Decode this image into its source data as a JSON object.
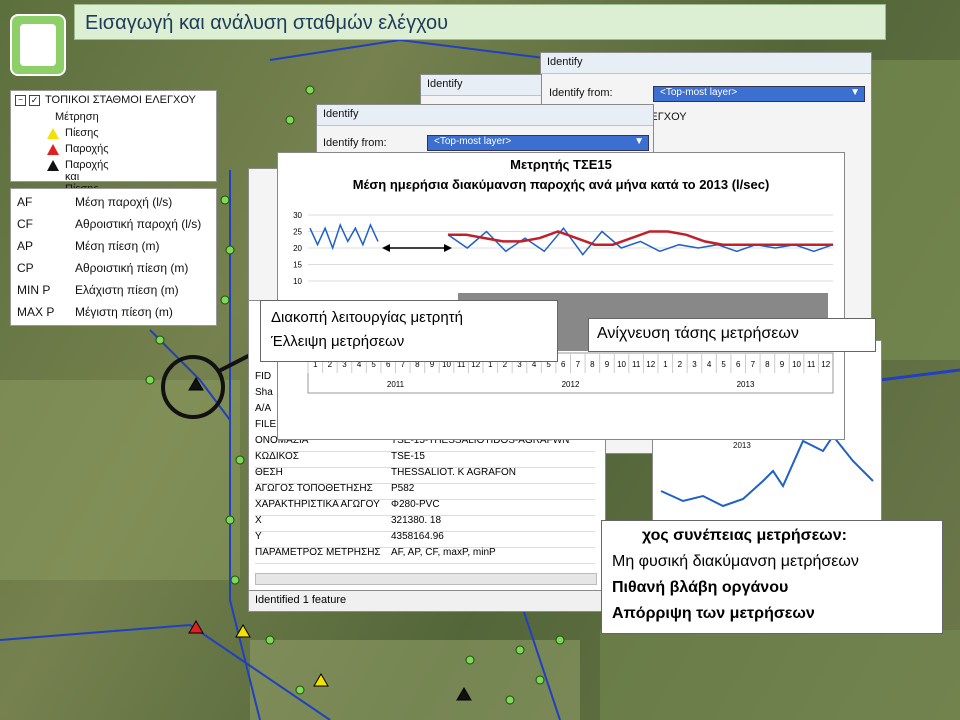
{
  "header": {
    "title": "Εισαγωγή και ανάλυση σταθμών ελέγχου"
  },
  "legend": {
    "layer": "ΤΟΠΙΚΟΙ ΣΤΑΘΜΟΙ ΕΛΕΓΧΟΥ",
    "group": "Μέτρηση",
    "items": [
      {
        "label": "Πίεσης",
        "color": "#f5e000"
      },
      {
        "label": "Παροχής",
        "color": "#e02020"
      },
      {
        "label": "Παροχής και Πίεσης",
        "color": "#111111"
      }
    ]
  },
  "abbreviations": [
    {
      "code": "AF",
      "desc": "Μέση παροχή (l/s)"
    },
    {
      "code": "CF",
      "desc": "Αθροιστική παροχή (l/s)"
    },
    {
      "code": "AP",
      "desc": "Μέση πίεση (m)"
    },
    {
      "code": "CP",
      "desc": "Αθροιστική πίεση (m)"
    },
    {
      "code": "MIN P",
      "desc": "Ελάχιστη πίεση (m)"
    },
    {
      "code": "MAX P",
      "desc": "Μέγιστη πίεση (m)"
    }
  ],
  "identify_windows": [
    {
      "title": "Identify",
      "from_label": "Identify from:",
      "from_value": "<Top-most layer>"
    },
    {
      "title": "Identify",
      "from_label": "",
      "from_value": ""
    },
    {
      "title": "Identify",
      "from_label": "Identify from:",
      "from_value": "<Top-most layer>"
    }
  ],
  "right_window_layer": "ΟΙ ΕΛΕΓΧΟΥ",
  "chart": {
    "title_line1": "Μετρητής ΤΣΕ15",
    "title_line2": "Μέση ημερήσια διακύμανση παροχής ανά μήνα κατά το 2013 (l/sec)",
    "yticks": [
      "30",
      "25",
      "20",
      "15",
      "10"
    ],
    "months": [
      "1",
      "2",
      "3",
      "4",
      "5",
      "6",
      "7",
      "8",
      "9",
      "10",
      "11",
      "12"
    ],
    "years": [
      "2011",
      "2012",
      "2013"
    ]
  },
  "chart_data": {
    "type": "line",
    "title": "Μετρητής ΤΣΕ15",
    "subtitle": "Μέση ημερήσια διακύμανση παροχής ανά μήνα κατά το 2013 (l/sec)",
    "ylim": [
      10,
      30
    ],
    "series": [
      {
        "values": [
          26,
          21,
          26,
          20,
          27,
          22,
          26,
          21,
          27,
          22
        ]
      },
      {
        "values": [
          24,
          20,
          25,
          19,
          23,
          19,
          26,
          18,
          25,
          20,
          22,
          19,
          21,
          20,
          21,
          19,
          21,
          20,
          21,
          19,
          21
        ]
      },
      {
        "values": [
          24,
          24,
          23,
          22,
          22,
          23,
          25,
          23,
          21,
          21,
          23,
          25,
          25,
          24,
          22,
          21,
          21,
          21,
          21,
          21,
          21,
          21
        ]
      }
    ]
  },
  "notes": {
    "n1_line1": "Διακοπή λειτουργίας μετρητή",
    "n1_line2": "Έλλειψη μετρήσεων",
    "n2": "Ανίχνευση τάσης μετρήσεων",
    "n3_line1": "χος συνέπειας  μετρήσεων:",
    "n3_line2": "Μη φυσική διακύμανση μετρήσεων",
    "n3_line3": "Πιθανή βλάβη οργάνου",
    "n3_line4": "Απόρριψη των μετρήσεων"
  },
  "attributes": [
    {
      "k": "ΟΝΟΜΑΣΙΑ",
      "v": "TSE-15-THESSALIOTIDOS-AGRAFWN"
    },
    {
      "k": "ΚΩΔΙΚΟΣ",
      "v": "TSE-15"
    },
    {
      "k": "ΘΕΣΗ",
      "v": "THESSALIOT. K AGRAFON"
    },
    {
      "k": "ΑΓΩΓΟΣ ΤΟΠΟΘΕΤΗΣΗΣ",
      "v": "P582"
    },
    {
      "k": "ΧΑΡΑΚΤΗΡΙΣΤΙΚΑ ΑΓΩΓΟΥ",
      "v": "Φ280-PVC"
    },
    {
      "k": "X",
      "v": "321380. 18"
    },
    {
      "k": "Y",
      "v": "4358164.96"
    },
    {
      "k": "ΠΑΡΑΜΕΤΡΟΣ ΜΕΤΡΗΣΗΣ",
      "v": "AF, AP, CF, maxP, minP"
    }
  ],
  "attr_left_labels": [
    "FID",
    "Sha",
    "A/A",
    "FILE"
  ],
  "status": "Identified 1 feature",
  "year_label_2013": "2013"
}
